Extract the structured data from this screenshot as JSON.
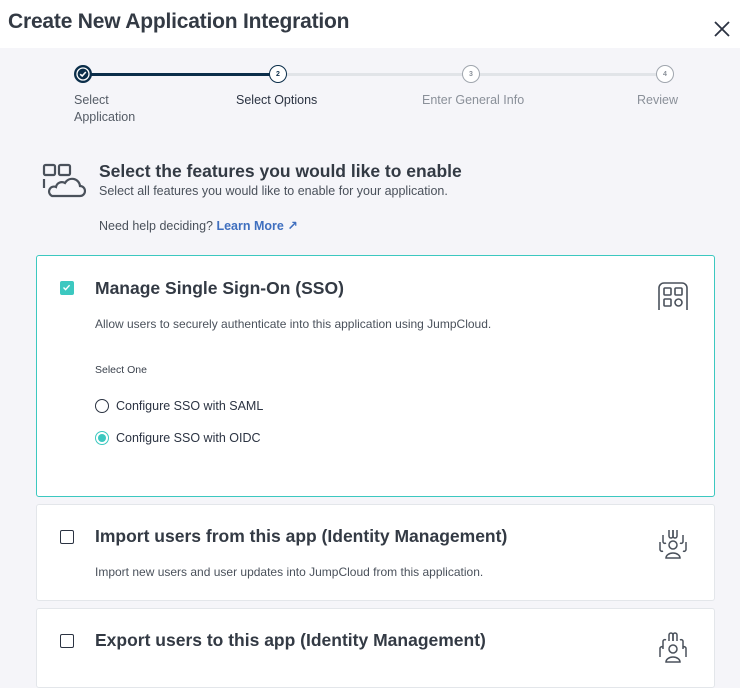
{
  "header": {
    "title": "Create New Application Integration",
    "close_icon": "close-icon"
  },
  "stepper": {
    "steps": [
      {
        "number": "1",
        "label": "Select Application",
        "state": "complete"
      },
      {
        "number": "2",
        "label": "Select Options",
        "state": "active"
      },
      {
        "number": "3",
        "label": "Enter General Info",
        "state": "future"
      },
      {
        "number": "4",
        "label": "Review",
        "state": "future"
      }
    ]
  },
  "intro": {
    "icon": "apps-cloud-icon",
    "title": "Select the features you would like to enable",
    "subtitle": "Select all features you would like to enable for your application.",
    "help_text": "Need help deciding?",
    "help_link": "Learn More",
    "help_link_icon": "↗"
  },
  "features": [
    {
      "title": "Manage Single Sign-On (SSO)",
      "description": "Allow users to securely authenticate into this application using JumpCloud.",
      "checked": true,
      "icon": "sso-apps-icon",
      "select_label": "Select One",
      "options": [
        {
          "label": "Configure SSO with SAML",
          "selected": false
        },
        {
          "label": "Configure SSO with OIDC",
          "selected": true
        }
      ]
    },
    {
      "title": "Import users from this app (Identity Management)",
      "description": "Import new users and user updates into JumpCloud from this application.",
      "checked": false,
      "icon": "import-users-icon"
    },
    {
      "title": "Export users to this app (Identity Management)",
      "checked": false,
      "icon": "export-users-icon"
    }
  ],
  "colors": {
    "accent": "#3cc8c0",
    "stepper_active": "#0b2e4a",
    "link": "#3f6fbf"
  }
}
